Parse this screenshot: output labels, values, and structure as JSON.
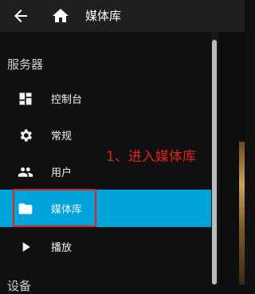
{
  "header": {
    "title": "媒体库",
    "back_icon": "arrow-left-icon",
    "home_icon": "home-icon"
  },
  "drawer": {
    "section_server": "服务器",
    "section_devices": "设备",
    "items": [
      {
        "label": "控制台",
        "icon": "dashboard-icon"
      },
      {
        "label": "常规",
        "icon": "gear-icon"
      },
      {
        "label": "用户",
        "icon": "users-icon"
      },
      {
        "label": "媒体库",
        "icon": "folder-icon",
        "active": true
      },
      {
        "label": "播放",
        "icon": "play-icon"
      }
    ]
  },
  "annotation": {
    "text": "1、进入媒体库"
  },
  "colors": {
    "accent": "#00a4dc",
    "annotation": "#e2231a",
    "header_bg": "#1f1f1f",
    "drawer_bg": "#101010"
  }
}
